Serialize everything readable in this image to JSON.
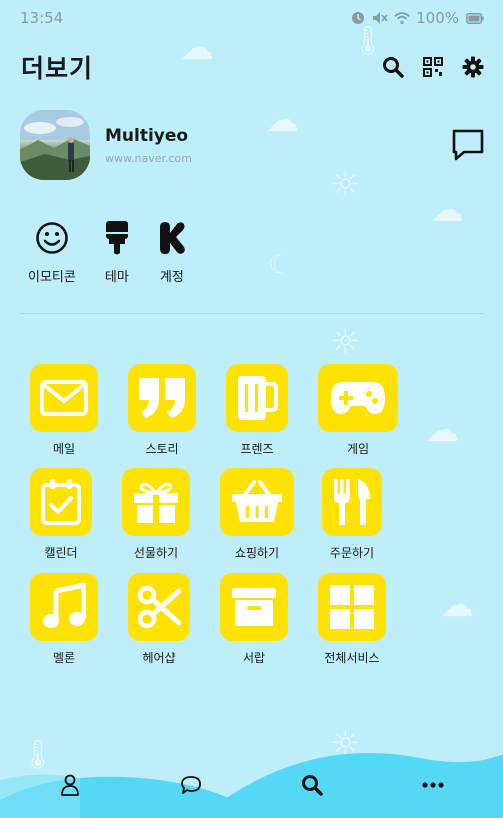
{
  "status_bar": {
    "time": "13:54",
    "battery": "100%"
  },
  "header": {
    "title": "더보기",
    "icons": [
      "search-icon",
      "qr-code-icon",
      "settings-gear-icon"
    ]
  },
  "profile": {
    "name": "Multiyeo",
    "subtitle": "www.naver.com"
  },
  "quick_menu": [
    {
      "label": "이모티콘",
      "icon": "smiley-icon"
    },
    {
      "label": "테마",
      "icon": "paint-brush-icon"
    },
    {
      "label": "계정",
      "icon": "kakao-k-icon"
    }
  ],
  "services": [
    {
      "label": "메일",
      "icon": "mail-icon"
    },
    {
      "label": "스토리",
      "icon": "quote-icon"
    },
    {
      "label": "프렌즈",
      "icon": "mug-icon"
    },
    {
      "label": "게임",
      "icon": "gamepad-icon"
    },
    {
      "label": "캘린더",
      "icon": "calendar-check-icon"
    },
    {
      "label": "선물하기",
      "icon": "gift-icon"
    },
    {
      "label": "쇼핑하기",
      "icon": "basket-icon"
    },
    {
      "label": "주문하기",
      "icon": "fork-knife-icon"
    },
    {
      "label": "멜론",
      "icon": "music-note-icon"
    },
    {
      "label": "헤어샵",
      "icon": "scissors-icon"
    },
    {
      "label": "서랍",
      "icon": "drawer-box-icon"
    },
    {
      "label": "전체서비스",
      "icon": "grid-icon"
    }
  ],
  "bottom_nav": [
    "person-icon",
    "chat-bubble-icon",
    "search-icon",
    "more-dots-icon"
  ],
  "colors": {
    "background": "#bdeefa",
    "tile": "#ffe202",
    "wave": "#55d8f5"
  }
}
